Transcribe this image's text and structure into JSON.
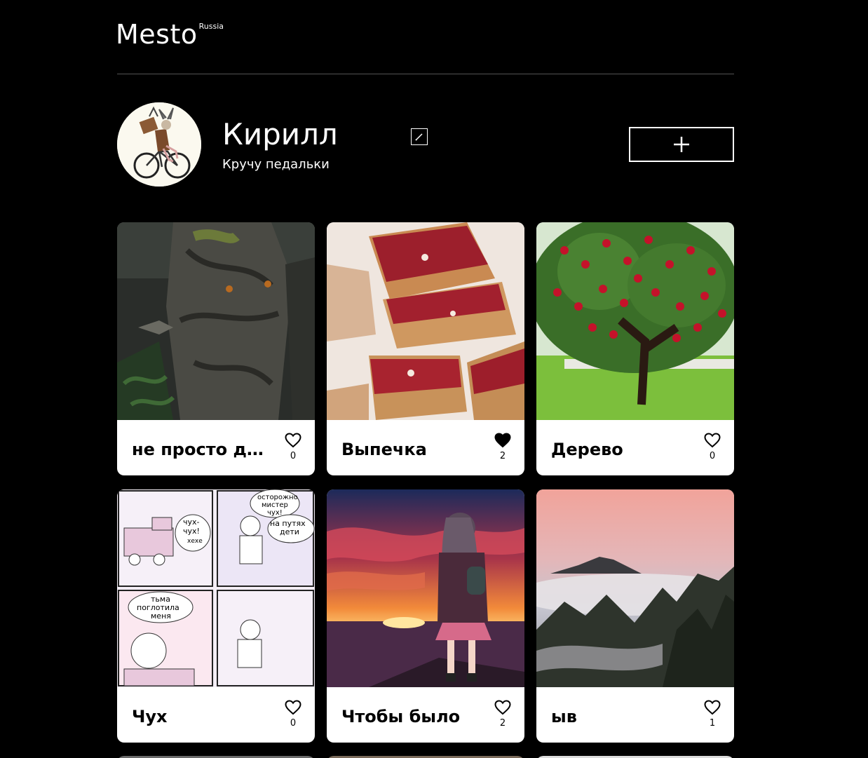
{
  "header": {
    "logo": "Mesto",
    "logo_sup": "Russia"
  },
  "profile": {
    "name": "Кирилл",
    "about": "Кручу педальки"
  },
  "cards": [
    {
      "title": "не просто дер...",
      "likes": "0",
      "liked": false,
      "image": "ent-tree"
    },
    {
      "title": "Выпечка",
      "likes": "2",
      "liked": true,
      "image": "jam-bars"
    },
    {
      "title": "Дерево",
      "likes": "0",
      "liked": false,
      "image": "apple-tree"
    },
    {
      "title": "Чух",
      "likes": "0",
      "liked": false,
      "image": "train-comic"
    },
    {
      "title": "Чтобы было",
      "likes": "2",
      "liked": false,
      "image": "anime-sunset"
    },
    {
      "title": "ыв",
      "likes": "1",
      "liked": false,
      "image": "misty-mountains"
    }
  ],
  "comic_text": [
    "осторожно",
    "мистер",
    "чух!",
    "чух-",
    "чух!",
    "хехе",
    "на путях",
    "дети",
    "тьма",
    "поглотила",
    "меня"
  ],
  "colors": {
    "background": "#000000",
    "card": "#ffffff",
    "divider": "#545454"
  }
}
